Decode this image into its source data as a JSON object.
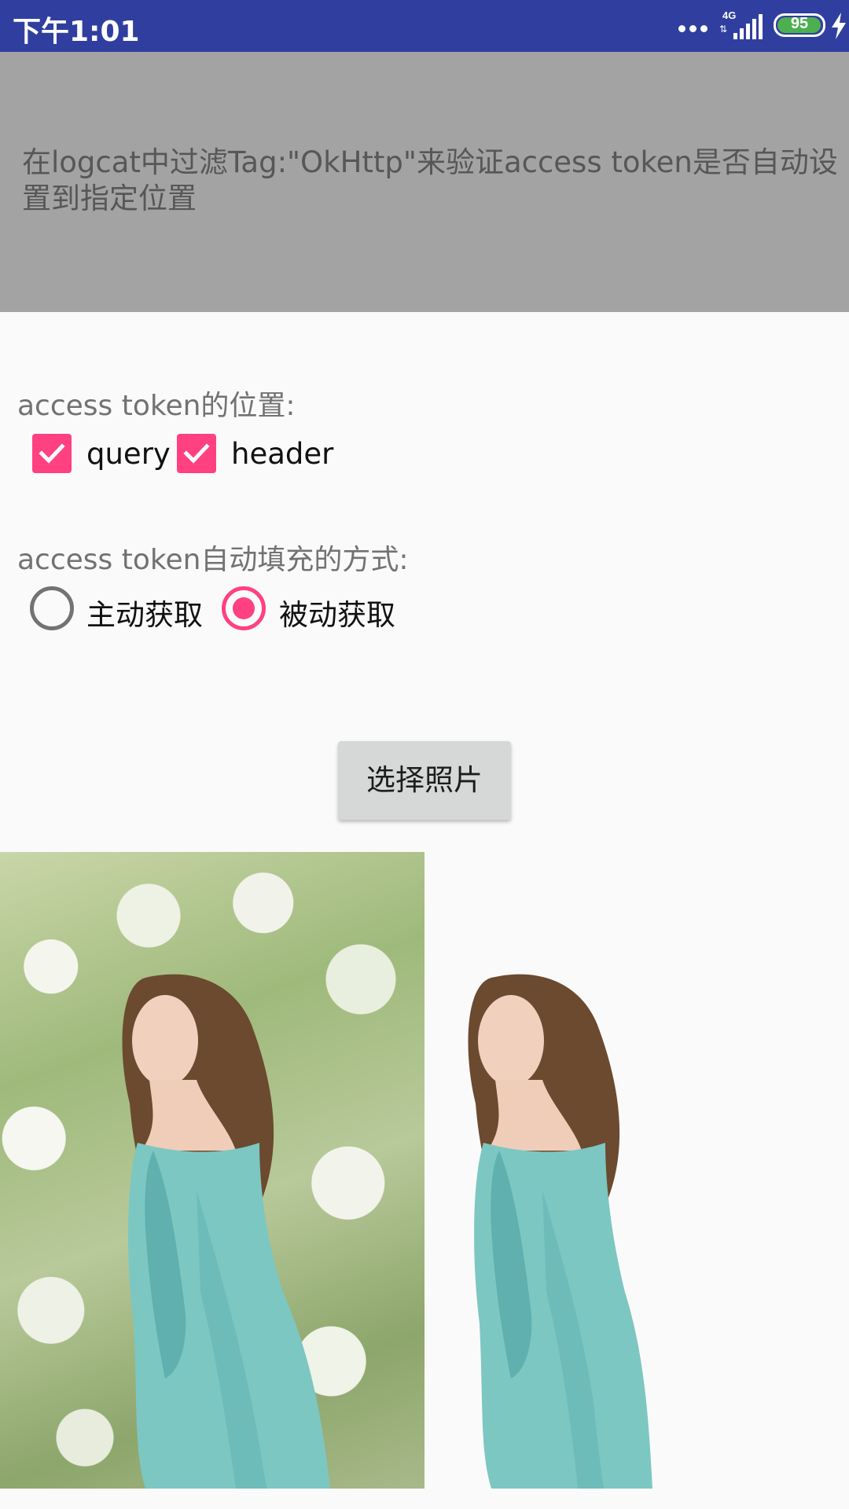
{
  "status_bar": {
    "time": "下午1:01",
    "network": "4G",
    "battery_level": "95",
    "icons": [
      "more-dots-icon",
      "signal-icon",
      "battery-icon",
      "charging-icon"
    ],
    "colors": {
      "background": "#303f9f",
      "battery": "#4caf50"
    }
  },
  "banner": {
    "text": "在logcat中过滤Tag:\"OkHttp\"来验证access token是否自动设置到指定位置"
  },
  "location_section": {
    "label": "access token的位置:",
    "options": [
      {
        "label": "query",
        "checked": true
      },
      {
        "label": "header",
        "checked": true
      }
    ]
  },
  "method_section": {
    "label": "access token自动填充的方式:",
    "options": [
      {
        "label": "主动获取",
        "selected": false
      },
      {
        "label": "被动获取",
        "selected": true
      }
    ]
  },
  "pick_photo_button": {
    "label": "选择照片"
  },
  "images": [
    {
      "name": "original-photo",
      "description_icon": "photo-icon"
    },
    {
      "name": "cutout-photo",
      "description_icon": "photo-icon"
    }
  ],
  "theme": {
    "accent": "#ff4081",
    "banner_bg": "#a3a3a3",
    "page_bg": "#fafafa"
  }
}
